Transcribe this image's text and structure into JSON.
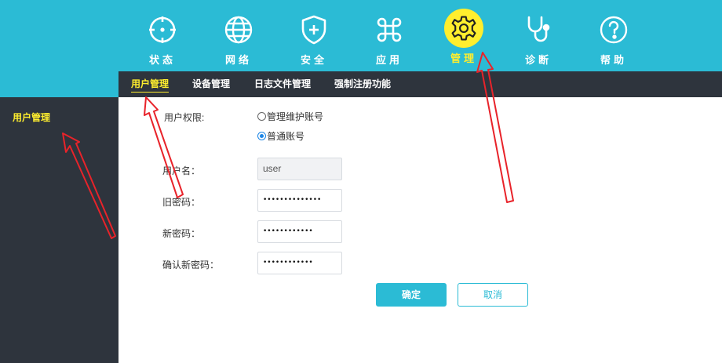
{
  "nav": {
    "items": [
      {
        "label": "状态",
        "icon": "crosshair-icon"
      },
      {
        "label": "网络",
        "icon": "globe-icon"
      },
      {
        "label": "安全",
        "icon": "shield-plus-icon"
      },
      {
        "label": "应用",
        "icon": "command-icon"
      },
      {
        "label": "管理",
        "icon": "gear-icon",
        "active": true
      },
      {
        "label": "诊断",
        "icon": "stethoscope-icon"
      },
      {
        "label": "帮助",
        "icon": "help-icon"
      }
    ],
    "accent_color": "#ffee2e",
    "bar_color": "#2bbbd5"
  },
  "subnav": {
    "tabs": [
      {
        "label": "用户管理",
        "active": true
      },
      {
        "label": "设备管理"
      },
      {
        "label": "日志文件管理"
      },
      {
        "label": "强制注册功能"
      }
    ]
  },
  "sidebar": {
    "items": [
      {
        "label": "用户管理",
        "active": true
      }
    ]
  },
  "form": {
    "permission_label": "用户权限:",
    "permission_options": [
      {
        "label": "管理维护账号",
        "checked": false
      },
      {
        "label": "普通账号",
        "checked": true
      }
    ],
    "username_label": "用户名：",
    "username_value": "user",
    "old_password_label": "旧密码：",
    "old_password_value": "••••••••••••••",
    "new_password_label": "新密码：",
    "new_password_value": "••••••••••••",
    "confirm_password_label": "确认新密码：",
    "confirm_password_value": "••••••••••••",
    "ok_label": "确定",
    "cancel_label": "取消"
  },
  "annotation_color": "#e8232a"
}
